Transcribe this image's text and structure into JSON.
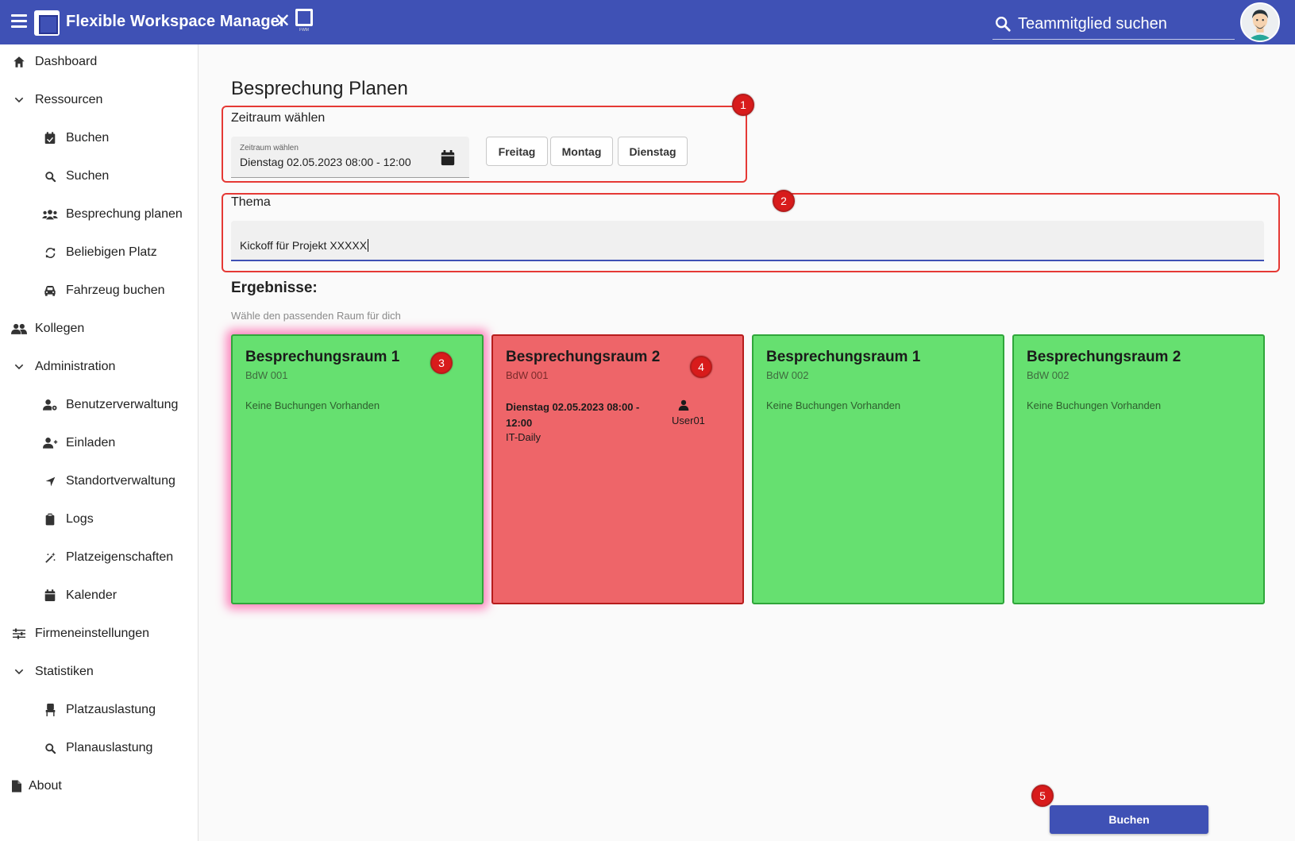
{
  "header": {
    "app_title": "Flexible Workspace Manager",
    "close_glyph": "✕",
    "logo_caption": "FWM",
    "search_text": "Teammitglied suchen"
  },
  "sidebar": {
    "items": [
      {
        "label": "Dashboard",
        "icon": "home-icon",
        "level": 0
      },
      {
        "label": "Ressourcen",
        "icon": "chevron-down-icon",
        "level": 0
      },
      {
        "label": "Buchen",
        "icon": "calendar-check-icon",
        "level": 1
      },
      {
        "label": "Suchen",
        "icon": "search-icon",
        "level": 1
      },
      {
        "label": "Besprechung planen",
        "icon": "group-icon",
        "level": 1
      },
      {
        "label": "Beliebigen Platz",
        "icon": "sync-icon",
        "level": 1
      },
      {
        "label": "Fahrzeug buchen",
        "icon": "car-icon",
        "level": 1
      },
      {
        "label": "Kollegen",
        "icon": "people-icon",
        "level": 0
      },
      {
        "label": "Administration",
        "icon": "chevron-down-icon",
        "level": 0
      },
      {
        "label": "Benutzerverwaltung",
        "icon": "user-gear-icon",
        "level": 1
      },
      {
        "label": "Einladen",
        "icon": "user-plus-icon",
        "level": 1
      },
      {
        "label": "Standortverwaltung",
        "icon": "location-arrow-icon",
        "level": 1
      },
      {
        "label": "Logs",
        "icon": "clipboard-icon",
        "level": 1
      },
      {
        "label": "Platzeigenschaften",
        "icon": "magic-wand-icon",
        "level": 1
      },
      {
        "label": "Kalender",
        "icon": "calendar-icon",
        "level": 1
      },
      {
        "label": "Firmeneinstellungen",
        "icon": "sliders-icon",
        "level": 0
      },
      {
        "label": "Statistiken",
        "icon": "chevron-down-icon",
        "level": 0
      },
      {
        "label": "Platzauslastung",
        "icon": "chair-icon",
        "level": 1
      },
      {
        "label": "Planauslastung",
        "icon": "search-icon",
        "level": 1
      },
      {
        "label": "About",
        "icon": "file-icon",
        "level": 0
      }
    ]
  },
  "main": {
    "title": "Besprechung Planen",
    "period": {
      "label": "Zeitraum wählen",
      "field_label": "Zeitraum wählen",
      "value": "Dienstag 02.05.2023 08:00 - 12:00",
      "quick_buttons": [
        "Freitag",
        "Montag",
        "Dienstag"
      ]
    },
    "topic": {
      "label": "Thema",
      "value": "Kickoff für Projekt XXXXX"
    },
    "results": {
      "title": "Ergebnisse:",
      "subtitle": "Wähle den passenden Raum für dich",
      "no_bookings_text": "Keine Buchungen Vorhanden",
      "rooms": [
        {
          "name": "Besprechungsraum 1",
          "location": "BdW 001",
          "status": "free",
          "selected": true
        },
        {
          "name": "Besprechungsraum 2",
          "location": "BdW 001",
          "status": "booked",
          "booking": {
            "datetime": "Dienstag 02.05.2023 08:00 - 12:00",
            "topic": "IT-Daily",
            "user": "User01"
          }
        },
        {
          "name": "Besprechungsraum 1",
          "location": "BdW 002",
          "status": "free"
        },
        {
          "name": "Besprechungsraum 2",
          "location": "BdW 002",
          "status": "free"
        }
      ]
    },
    "book_button": "Buchen"
  },
  "annotations": [
    "1",
    "2",
    "3",
    "4",
    "5"
  ],
  "colors": {
    "primary": "#3f51b5",
    "room_free": "#66e070",
    "room_booked": "#ee6569",
    "annotation": "#d81b1b",
    "selection_glow": "#ff288c"
  }
}
